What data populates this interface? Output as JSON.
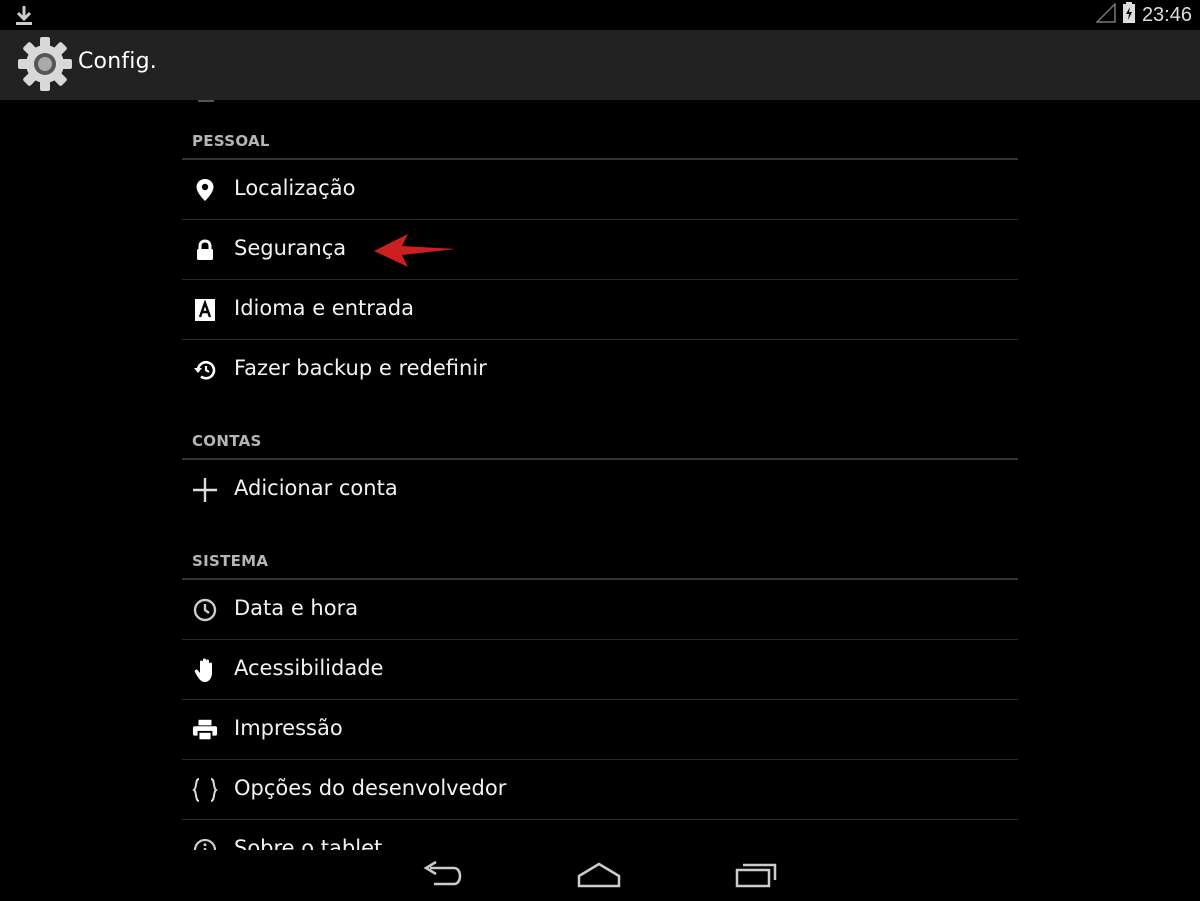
{
  "status_bar": {
    "time": "23:46",
    "left_icon": "download-icon",
    "signal_icon": "signal-icon",
    "battery_icon": "battery-icon"
  },
  "action_bar": {
    "icon": "gear-icon",
    "title": "Config."
  },
  "sections": [
    {
      "header": "PESSOAL",
      "items": [
        {
          "label": "Localização",
          "icon": "location-pin-icon"
        },
        {
          "label": "Segurança",
          "icon": "lock-icon"
        },
        {
          "label": "Idioma e entrada",
          "icon": "language-icon"
        },
        {
          "label": "Fazer backup e redefinir",
          "icon": "restore-icon"
        }
      ]
    },
    {
      "header": "CONTAS",
      "items": [
        {
          "label": "Adicionar conta",
          "icon": "plus-icon"
        }
      ]
    },
    {
      "header": "SISTEMA",
      "items": [
        {
          "label": "Data e hora",
          "icon": "clock-icon"
        },
        {
          "label": "Acessibilidade",
          "icon": "hand-icon"
        },
        {
          "label": "Impressão",
          "icon": "printer-icon"
        },
        {
          "label": "Opções do desenvolvedor",
          "icon": "braces-icon"
        },
        {
          "label": "Sobre o tablet",
          "icon": "info-icon"
        }
      ]
    }
  ],
  "annotation": {
    "icon": "red-arrow-icon",
    "color": "#cc1f1f"
  },
  "nav_bar": {
    "back_icon": "back-icon",
    "home_icon": "home-icon",
    "recents_icon": "recents-icon"
  },
  "colors": {
    "background": "#000000",
    "action_bar": "#222222",
    "header_text": "#b5b5b5",
    "item_text": "#f2f2f2"
  }
}
